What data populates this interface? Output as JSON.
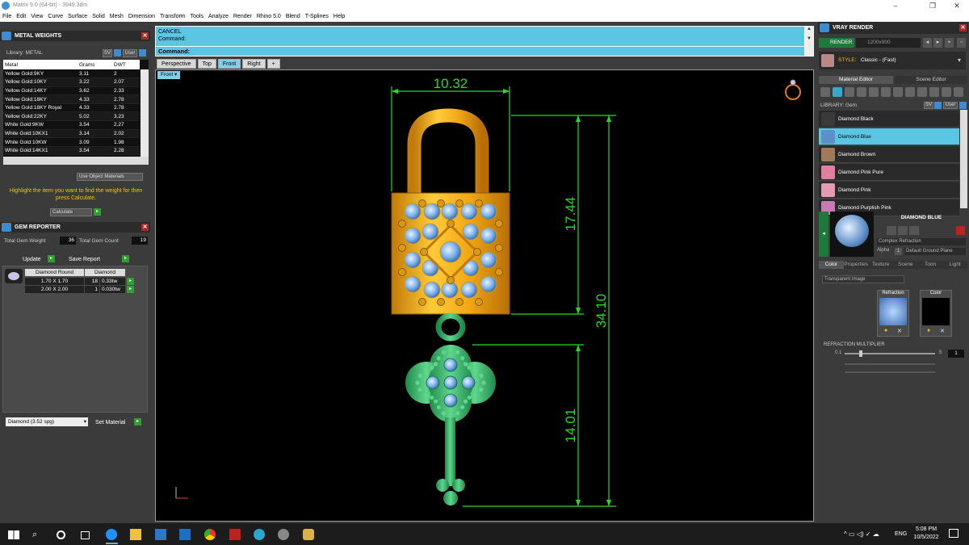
{
  "window": {
    "title": "Matrix 9.0 (64-bit) - 3949.3dm"
  },
  "menu": [
    "File",
    "Edit",
    "View",
    "Curve",
    "Surface",
    "Solid",
    "Mesh",
    "Dimension",
    "Transform",
    "Tools",
    "Analyze",
    "Render",
    "Rhino 5.0",
    "Blend",
    "T-Splines",
    "Help"
  ],
  "metal_weights": {
    "title": "METAL WEIGHTS",
    "library_label": "Library: METAL",
    "sv_label": "SV",
    "user_label": "User",
    "columns": [
      "Metal",
      "Grams",
      "DWT"
    ],
    "rows": [
      [
        "Yellow Gold:9KY",
        "3.11",
        "2"
      ],
      [
        "Yellow Gold:10KY",
        "3.22",
        "2.07"
      ],
      [
        "Yellow Gold:14KY",
        "3.62",
        "2.33"
      ],
      [
        "Yellow Gold:18KY",
        "4.33",
        "2.78"
      ],
      [
        "Yellow Gold:18KY Royal",
        "4.33",
        "2.78"
      ],
      [
        "Yellow Gold:22KY",
        "5.02",
        "3.23"
      ],
      [
        "White Gold:9KW",
        "3.54",
        "2.27"
      ],
      [
        "White Gold:10KX1",
        "3.14",
        "2.02"
      ],
      [
        "White Gold:10KW",
        "3.09",
        "1.98"
      ],
      [
        "White Gold:14KX1",
        "3.54",
        "2.28"
      ]
    ],
    "use_object_materials": "Use Object Materials",
    "hint": "Highlight the item you want to find the weight for then press Calculate.",
    "calculate": "Calculate"
  },
  "gem_reporter": {
    "title": "GEM REPORTER",
    "total_gem_weight_label": "Total Gem Weight",
    "total_gem_weight": "36",
    "total_gem_count_label": "Total Gem Count",
    "total_gem_count": "19",
    "update": "Update",
    "save_report": "Save Report",
    "col_shape": "Diamond Round",
    "col_type": "Diamond",
    "rows": [
      {
        "size": "1.70 X 1.70",
        "count": "18",
        "weight": "0.33tw"
      },
      {
        "size": "2.00 X 2.00",
        "count": "1",
        "weight": "0.030tw"
      }
    ],
    "material_select": "Diamond    (3.52 spg)",
    "set_material": "Set Material"
  },
  "command": {
    "line1": "CANCEL",
    "line2": "Command:",
    "prompt": "Command:"
  },
  "viewport_tabs": [
    "Perspective",
    "Top",
    "Front",
    "Right",
    "+"
  ],
  "active_tab": "Front",
  "viewport_label": "Front",
  "dimensions": {
    "width": "10.32",
    "lock_height": "17.44",
    "total_height": "34.10",
    "key_height": "14.01"
  },
  "vray": {
    "title": "VRAY RENDER",
    "render_label": "RENDER",
    "resolution": "1200x900",
    "style_label": "STYLE:",
    "style_value": "Classic - (Fast)",
    "tab_material": "Material Editor",
    "tab_scene": "Scene Editor",
    "library_label": "LIBRARY: Gem",
    "materials": [
      {
        "name": "Diamond Black",
        "color": "#3a3a3a"
      },
      {
        "name": "Diamond Blue",
        "color": "#5e8fc9"
      },
      {
        "name": "Diamond Brown",
        "color": "#9c7a5a"
      },
      {
        "name": "Diamond Pink Pure",
        "color": "#e07fa0"
      },
      {
        "name": "Diamond Pink",
        "color": "#e49ab5"
      },
      {
        "name": "Diamond Purplish Pink",
        "color": "#c77ab3"
      }
    ],
    "selected_material": "DIAMOND BLUE",
    "refraction_type": "Complex Refraction",
    "alpha_label": "Alpha",
    "ground_plane": "Default Ground Plane",
    "subtabs": [
      "Color",
      "Properties",
      "Texture",
      "Scene",
      "Toon",
      "Light"
    ],
    "transparent_mode": "Transparent Image",
    "refraction_label": "Refraction",
    "color_label": "Color",
    "refraction_multiplier_label": "REFRACTION MULTIPLIER",
    "rm_min": "0.1",
    "rm_max": "5",
    "rm_value": "1"
  },
  "taskbar": {
    "time": "5:08 PM",
    "date": "10/5/2022",
    "lang": "ENG"
  },
  "colors": {
    "accent": "#5bc6e3",
    "dim": "#22dd22",
    "gold": "#f2a816",
    "gem_green": "#3db36c",
    "gem_blue": "#7fb2ea"
  }
}
